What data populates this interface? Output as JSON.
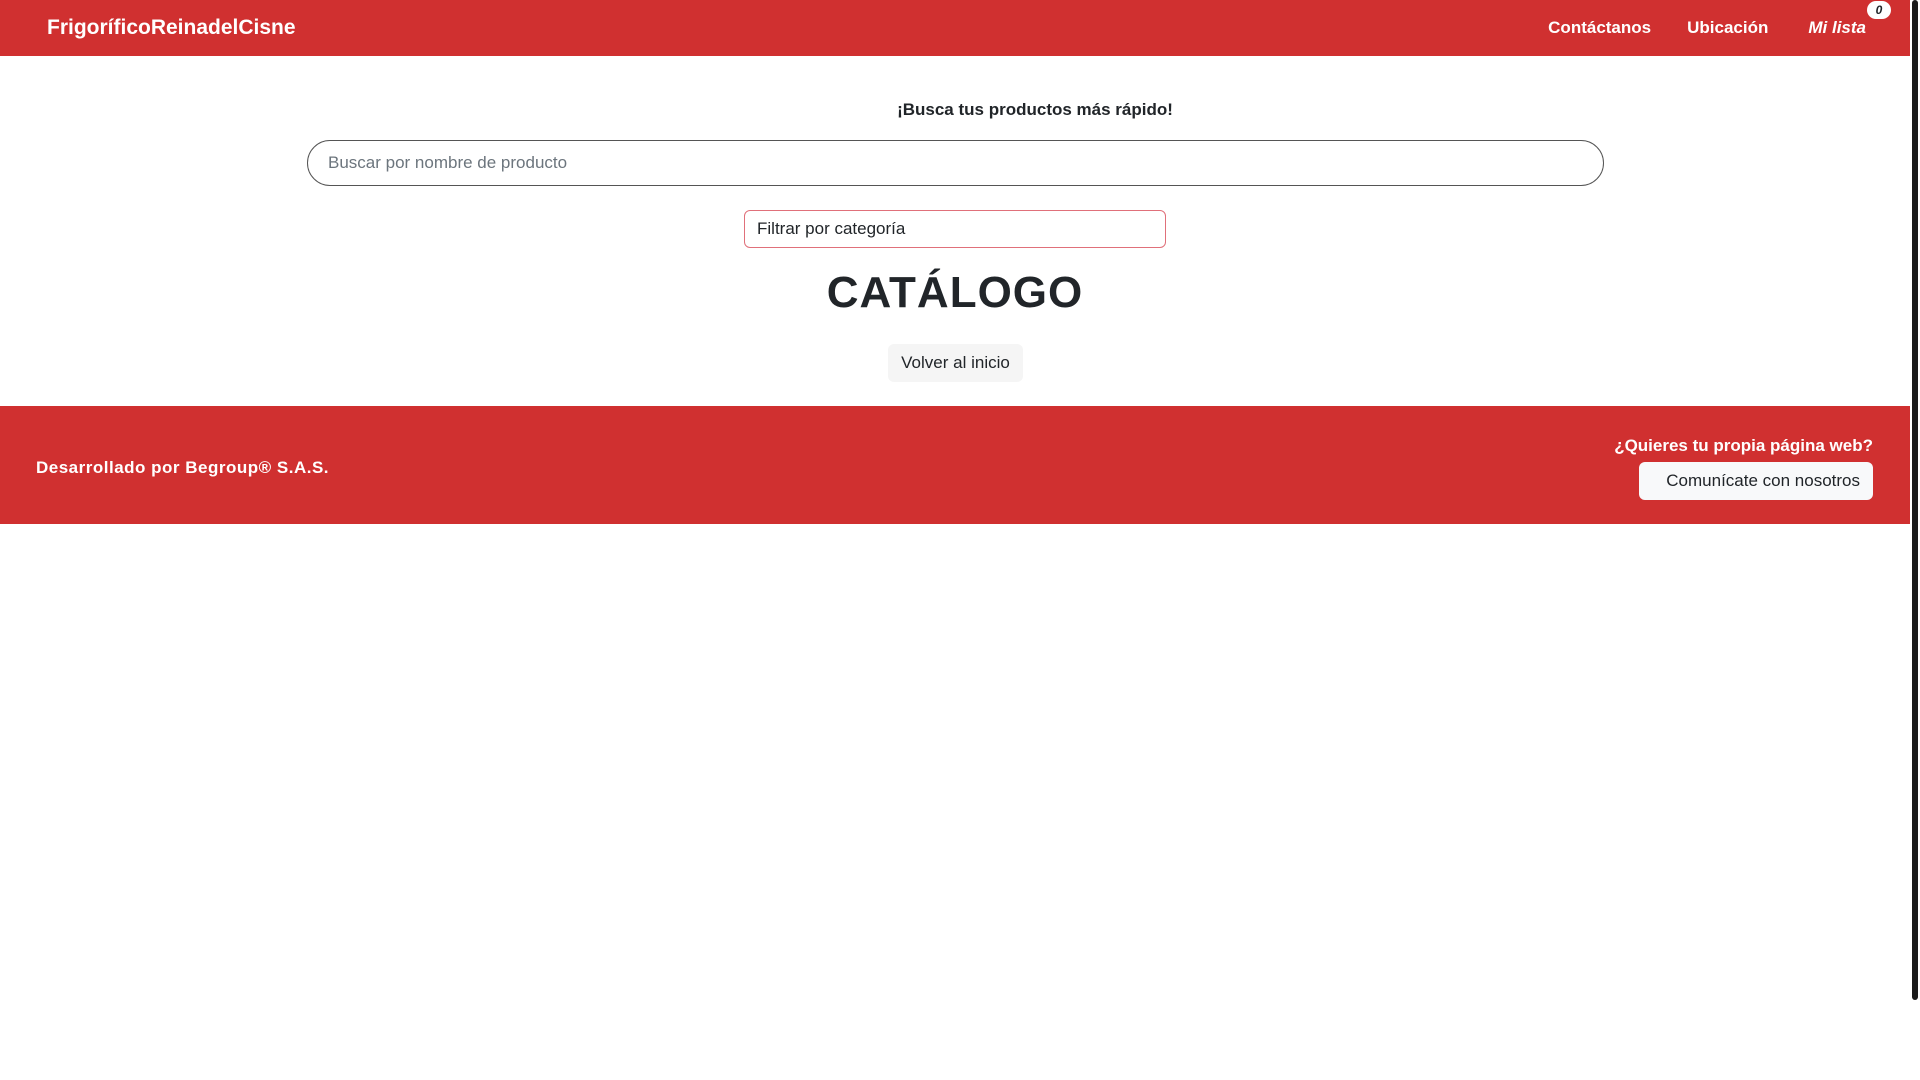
{
  "header": {
    "brand": "FrigoríficoReinadelCisne",
    "nav": {
      "contact": "Contáctanos",
      "location": "Ubicación",
      "cart_label": "Mi lista",
      "cart_count": "0"
    }
  },
  "main": {
    "search_title": "¡Busca tus productos más rápido!",
    "search_placeholder": "Buscar por nombre de producto",
    "filter_selected": "Filtrar por categoría",
    "catalog_title": "CATÁLOGO",
    "back_button": "Volver al inicio"
  },
  "footer": {
    "credit": "Desarrollado por Begroup® S.A.S.",
    "cta_question": "¿Quieres tu propia página web?",
    "cta_button": "Comunícate con nosotros"
  },
  "colors": {
    "brand_red": "#d03030",
    "text_dark": "#212529"
  }
}
